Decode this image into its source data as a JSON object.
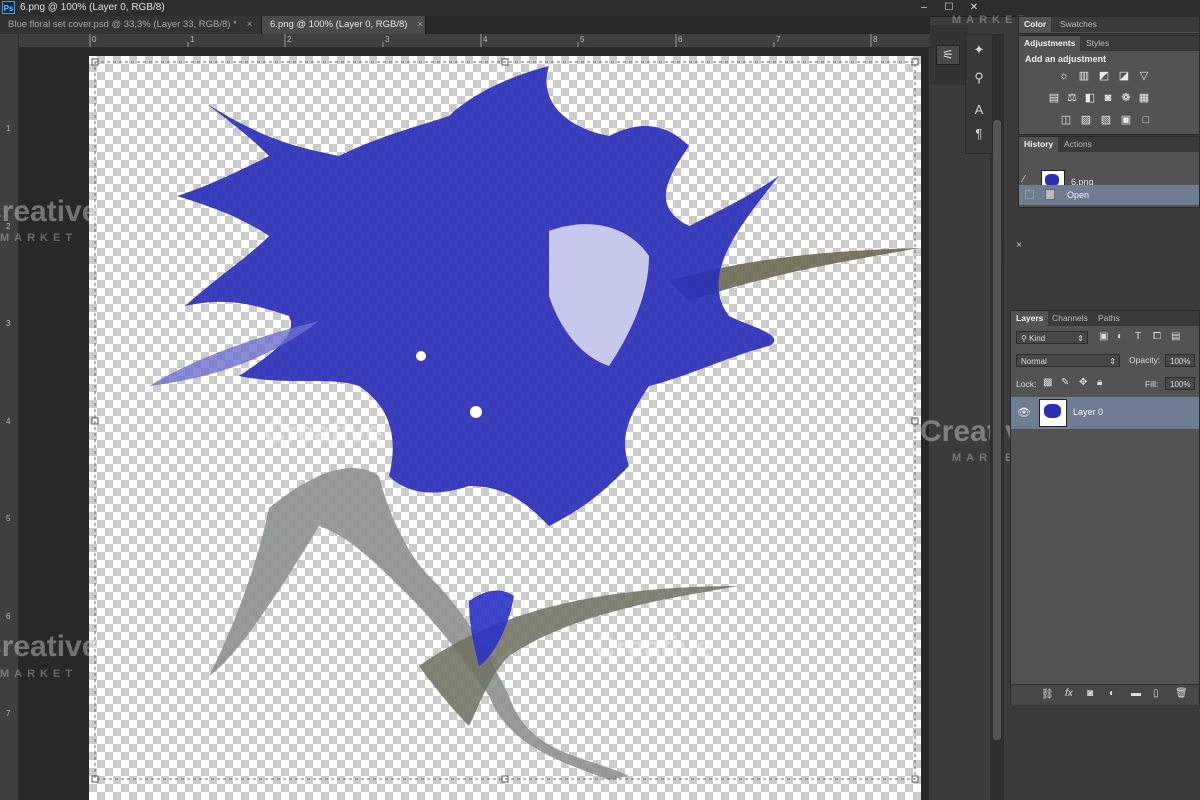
{
  "app": {
    "logo": "Ps",
    "window_title": "6.png @ 100% (Layer 0, RGB/8)",
    "window_controls": [
      "–",
      "☐",
      "✕"
    ]
  },
  "document_tabs": [
    {
      "label": "Blue floral set cover.psd @ 33,3% (Layer 33, RGB/8) *",
      "close": "×",
      "active": false
    },
    {
      "label": "6.png @ 100% (Layer 0, RGB/8)",
      "close": "×",
      "active": true
    }
  ],
  "ruler": {
    "top_numbers": [
      "0",
      "1",
      "2",
      "3",
      "4",
      "5",
      "6",
      "7",
      "8"
    ],
    "left_numbers": [
      "1",
      "2",
      "3",
      "4",
      "5",
      "6",
      "7"
    ]
  },
  "color_panel": {
    "tabs": [
      "Color",
      "Swatches"
    ]
  },
  "adjustments_panel": {
    "tabs": [
      "Adjustments",
      "Styles"
    ],
    "heading": "Add an adjustment"
  },
  "history_panel": {
    "tabs": [
      "History",
      "Actions"
    ],
    "snapshot_label": "6.png",
    "items": [
      {
        "label": "Open",
        "selected": true
      }
    ]
  },
  "layers_panel": {
    "tabs": [
      "Layers",
      "Channels",
      "Paths"
    ],
    "filter_kind": "Kind",
    "blend_mode": "Normal",
    "opacity_label": "Opacity:",
    "opacity_value": "100%",
    "lock_label": "Lock:",
    "fill_label": "Fill:",
    "fill_value": "100%",
    "layers": [
      {
        "name": "Layer 0",
        "visible": true,
        "selected": true
      }
    ],
    "footer_icons": [
      "link-icon",
      "fx-icon",
      "mask-icon",
      "adjustment-icon",
      "folder-icon",
      "new-layer-icon",
      "trash-icon"
    ],
    "fx_label": "fx"
  },
  "watermarks": {
    "brand": "Creative",
    "sub": "MARKET"
  },
  "colors": {
    "panel_bg": "#535353",
    "selected_row": "#6f7d93",
    "flower_blue": "#2b2fb8",
    "stem_grey": "#6e7268"
  }
}
